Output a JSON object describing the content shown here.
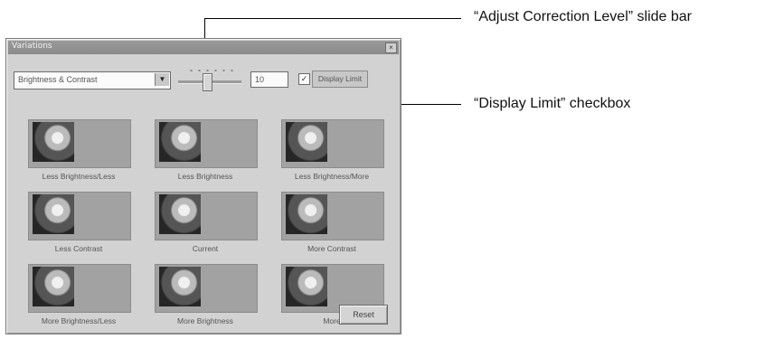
{
  "callouts": {
    "slider": "“Adjust Correction Level” slide bar",
    "checkbox": "“Display Limit” checkbox"
  },
  "dialog": {
    "title": "Variations",
    "close_glyph": "×",
    "dropdown": {
      "selected": "Brightness & Contrast",
      "arrow": "▼"
    },
    "slider": {
      "level": 0.45
    },
    "correction_level": "10",
    "display_limit": {
      "checked": true,
      "glyph": "✓",
      "label": "Display Limit"
    },
    "thumbnails": [
      {
        "label": "Less Brightness/Less"
      },
      {
        "label": "Less Brightness"
      },
      {
        "label": "Less Brightness/More"
      },
      {
        "label": "Less Contrast"
      },
      {
        "label": "Current"
      },
      {
        "label": "More Contrast"
      },
      {
        "label": "More Brightness/Less"
      },
      {
        "label": "More Brightness"
      },
      {
        "label": "More"
      }
    ],
    "reset_label": "Reset"
  }
}
